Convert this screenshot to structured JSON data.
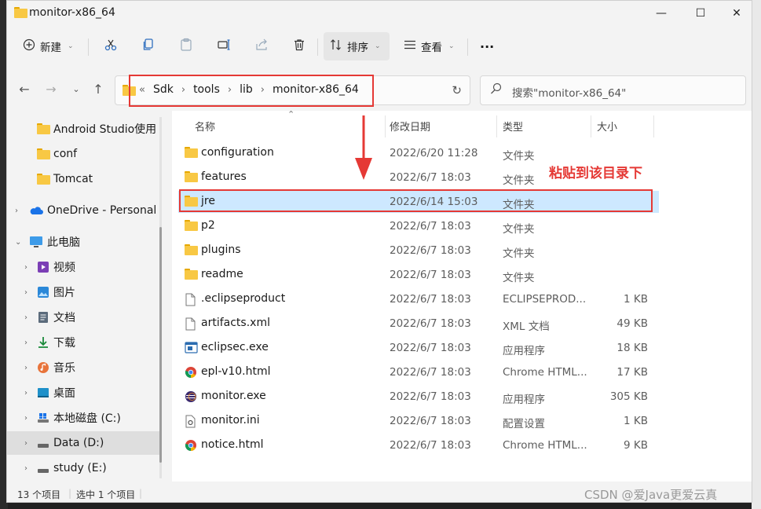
{
  "window": {
    "title": "monitor-x86_64"
  },
  "window_controls": {
    "minimize": "—",
    "maximize": "☐",
    "close": "✕"
  },
  "toolbar": {
    "new_label": "新建",
    "sort_label": "排序",
    "view_label": "查看",
    "more_label": "···"
  },
  "address": {
    "overflow": "«",
    "crumbs": [
      "Sdk",
      "tools",
      "lib",
      "monitor-x86_64"
    ],
    "search_placeholder": "搜索\"monitor-x86_64\""
  },
  "sidebar": {
    "items": [
      {
        "label": "Android Studio使用"
      },
      {
        "label": "conf"
      },
      {
        "label": "Tomcat"
      },
      {
        "label": "OneDrive - Personal"
      },
      {
        "label": "此电脑"
      },
      {
        "label": "视频"
      },
      {
        "label": "图片"
      },
      {
        "label": "文档"
      },
      {
        "label": "下载"
      },
      {
        "label": "音乐"
      },
      {
        "label": "桌面"
      },
      {
        "label": "本地磁盘 (C:)"
      },
      {
        "label": "Data (D:)"
      },
      {
        "label": "study (E:)"
      }
    ]
  },
  "columns": {
    "name": "名称",
    "date": "修改日期",
    "type": "类型",
    "size": "大小"
  },
  "files": [
    {
      "name": "configuration",
      "date": "2022/6/20 11:28",
      "type": "文件夹",
      "size": "",
      "icon": "folder-icon"
    },
    {
      "name": "features",
      "date": "2022/6/7 18:03",
      "type": "文件夹",
      "size": "",
      "icon": "folder-icon"
    },
    {
      "name": "jre",
      "date": "2022/6/14 15:03",
      "type": "文件夹",
      "size": "",
      "icon": "folder-icon"
    },
    {
      "name": "p2",
      "date": "2022/6/7 18:03",
      "type": "文件夹",
      "size": "",
      "icon": "folder-icon"
    },
    {
      "name": "plugins",
      "date": "2022/6/7 18:03",
      "type": "文件夹",
      "size": "",
      "icon": "folder-icon"
    },
    {
      "name": "readme",
      "date": "2022/6/7 18:03",
      "type": "文件夹",
      "size": "",
      "icon": "folder-icon"
    },
    {
      "name": ".eclipseproduct",
      "date": "2022/6/7 18:03",
      "type": "ECLIPSEPROD...",
      "size": "1 KB",
      "icon": "file-icon"
    },
    {
      "name": "artifacts.xml",
      "date": "2022/6/7 18:03",
      "type": "XML 文档",
      "size": "49 KB",
      "icon": "file-icon"
    },
    {
      "name": "eclipsec.exe",
      "date": "2022/6/7 18:03",
      "type": "应用程序",
      "size": "18 KB",
      "icon": "exe-icon"
    },
    {
      "name": "epl-v10.html",
      "date": "2022/6/7 18:03",
      "type": "Chrome HTML...",
      "size": "17 KB",
      "icon": "chrome-icon"
    },
    {
      "name": "monitor.exe",
      "date": "2022/6/7 18:03",
      "type": "应用程序",
      "size": "305 KB",
      "icon": "eclipse-icon"
    },
    {
      "name": "monitor.ini",
      "date": "2022/6/7 18:03",
      "type": "配置设置",
      "size": "1 KB",
      "icon": "ini-icon"
    },
    {
      "name": "notice.html",
      "date": "2022/6/7 18:03",
      "type": "Chrome HTML...",
      "size": "9 KB",
      "icon": "chrome-icon"
    }
  ],
  "annotation": "粘贴到该目录下",
  "status": {
    "count": "13 个项目",
    "selected": "选中 1 个项目"
  },
  "watermark": "CSDN @爱Java更爱云真",
  "colors": {
    "highlight_red": "#e53935",
    "selection_blue": "#cde8ff",
    "folder_yellow": "#f8c844"
  }
}
